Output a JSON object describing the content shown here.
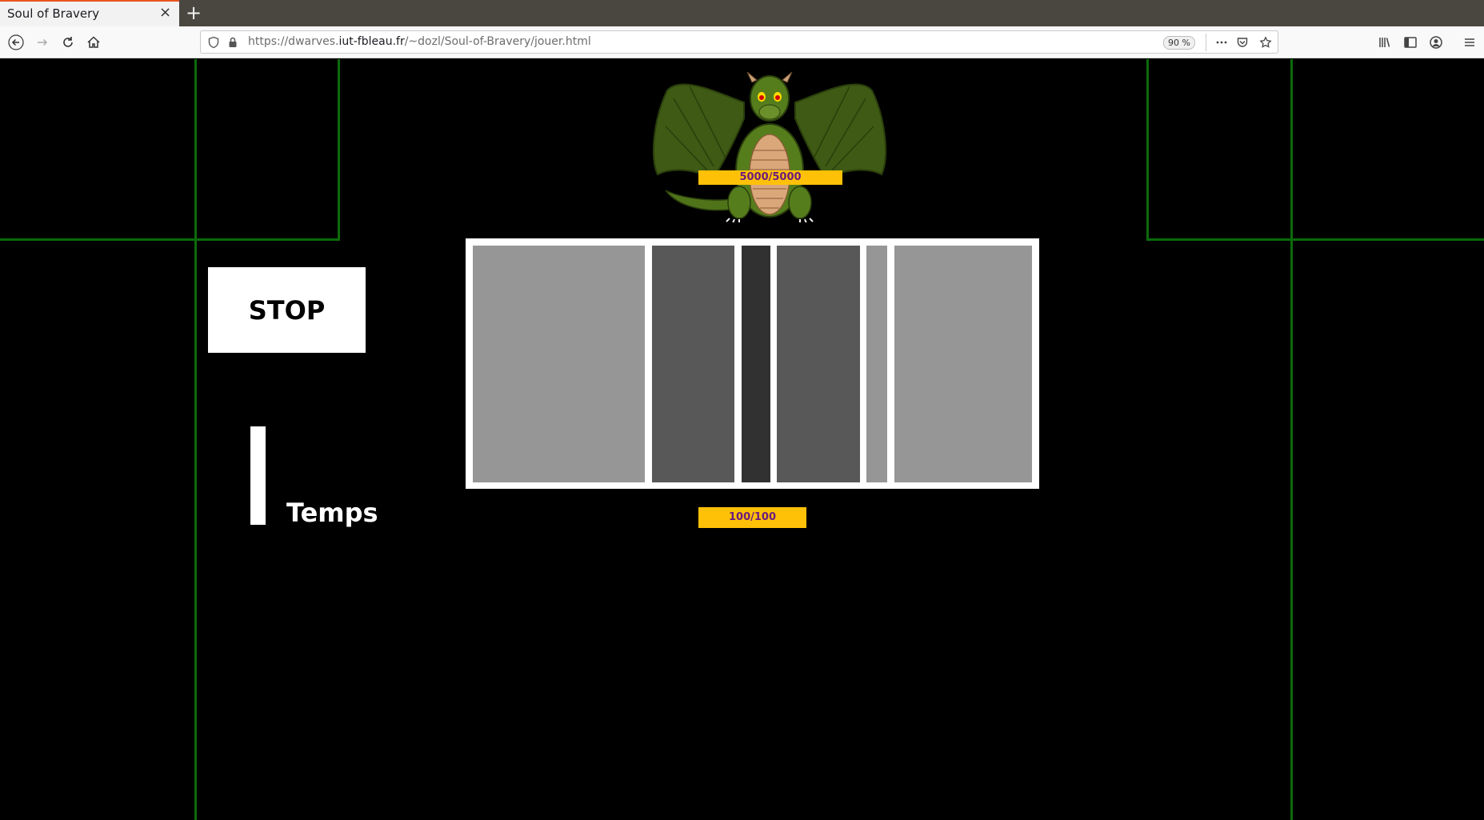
{
  "browser": {
    "tab_title": "Soul of Bravery",
    "tab_close": "×",
    "new_tab": "+",
    "url_prefix": "https://dwarves.",
    "url_host": "iut-fbleau.fr",
    "url_path": "/~dozl/Soul-of-Bravery/jouer.html",
    "zoom": "90 %",
    "accent_color": "#e95420",
    "icons": [
      "back-arrow-icon",
      "forward-arrow-icon",
      "reload-icon",
      "home-icon",
      "shield-icon",
      "lock-icon",
      "more-icon",
      "pocket-icon",
      "bookmark-star-icon",
      "library-icon",
      "sidebar-icon",
      "account-icon",
      "menu-icon"
    ]
  },
  "game": {
    "background_color": "#000000",
    "grid_color": "#0b6b0b",
    "boss": {
      "hp_text": "5000/5000",
      "hp_current": 5000,
      "hp_max": 5000,
      "hp_bar_color": "#ffc107",
      "hp_text_color": "#6a1b7f"
    },
    "stop_label": "STOP",
    "timer_label": "Temps",
    "timer_fill_fraction": 1.0,
    "player": {
      "hp_text": "100/100",
      "hp_current": 100,
      "hp_max": 100
    },
    "target_columns": [
      {
        "shade": "light",
        "color": "#969696"
      },
      {
        "shade": "medium",
        "color": "#585858"
      },
      {
        "shade": "dark",
        "color": "#313131"
      },
      {
        "shade": "medium",
        "color": "#585858"
      },
      {
        "shade": "light",
        "color": "#969696"
      },
      {
        "shade": "light",
        "color": "#969696"
      }
    ]
  }
}
